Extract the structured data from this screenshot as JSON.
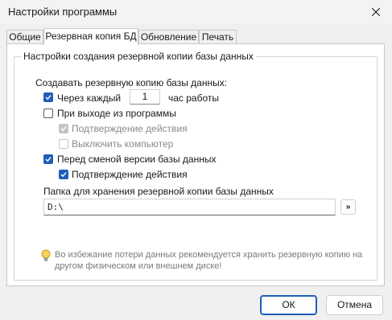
{
  "window": {
    "title": "Настройки программы"
  },
  "tabs": [
    {
      "label": "Общие",
      "active": false
    },
    {
      "label": "Резервная копия БД",
      "active": true
    },
    {
      "label": "Обновление",
      "active": false
    },
    {
      "label": "Печать",
      "active": false
    }
  ],
  "group": {
    "title": "Настройки создания резервной копии базы данных",
    "create_label": "Создавать резервную копию базы данных:",
    "every": {
      "label": "Через каждый",
      "value": "1",
      "suffix": "час работы",
      "checked": true
    },
    "on_exit": {
      "label": "При выходе из программы",
      "checked": false
    },
    "confirm_exit": {
      "label": "Подтверждение действия",
      "checked": true,
      "disabled": true
    },
    "shutdown": {
      "label": "Выключить компьютер",
      "checked": false,
      "disabled": true
    },
    "before_change": {
      "label": "Перед сменой версии базы данных",
      "checked": true
    },
    "confirm_change": {
      "label": "Подтверждение действия",
      "checked": true
    },
    "folder_label": "Папка для хранения резервной копии базы данных",
    "folder_value": "D:\\",
    "browse_label": "»",
    "hint": "Во избежание потери данных рекомендуется хранить резервную копию на другом физическом или внешнем диске!"
  },
  "buttons": {
    "ok": "ОК",
    "cancel": "Отмена"
  },
  "colors": {
    "accent": "#1f5fb8",
    "disabled": "#c4c4c4"
  }
}
